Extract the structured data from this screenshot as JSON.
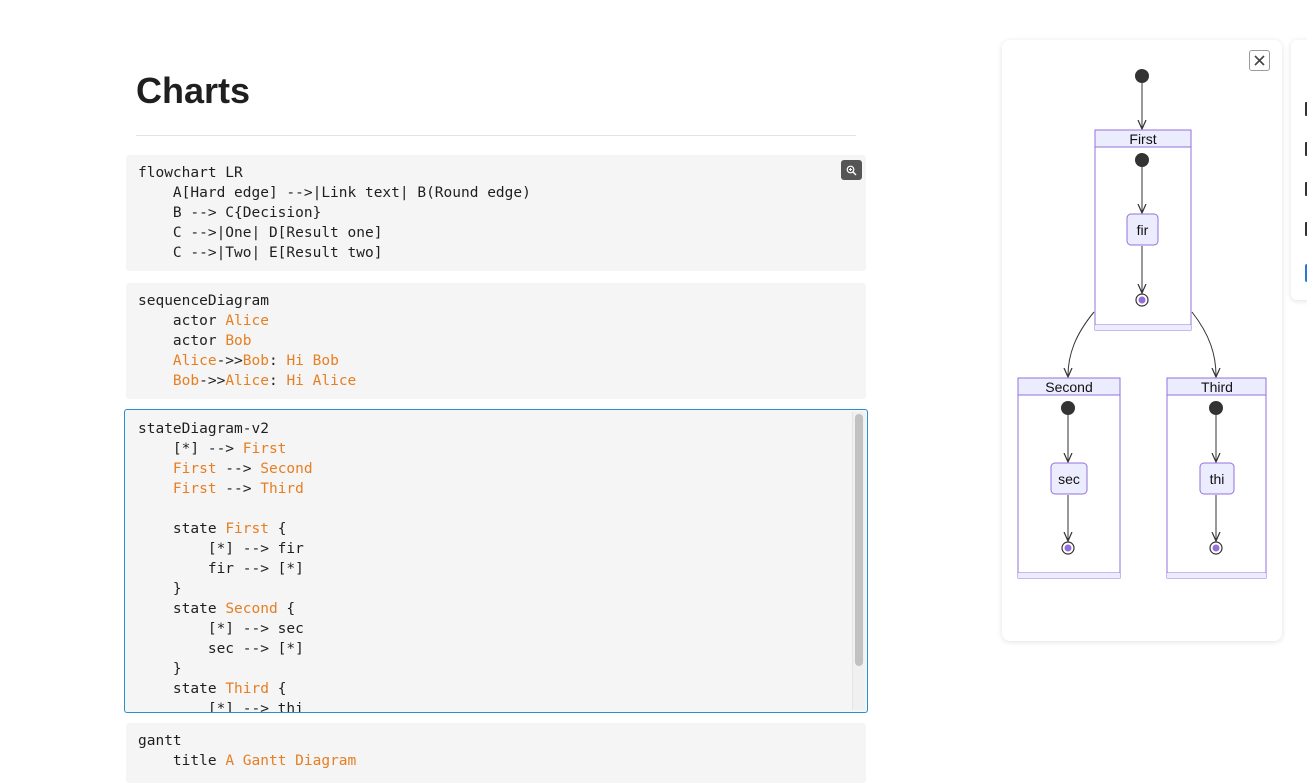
{
  "page": {
    "title": "Charts"
  },
  "code_blocks": {
    "flowchart": [
      "flowchart LR",
      "    A[Hard edge] -->|Link text| B(Round edge)",
      "    B --> C{Decision}",
      "    C -->|One| D[Result one]",
      "    C -->|Two| E[Result two]"
    ],
    "sequence": {
      "l0": "sequenceDiagram",
      "l1a": "    actor ",
      "l1b": "Alice",
      "l2a": "    actor ",
      "l2b": "Bob",
      "l3a": "    ",
      "l3b": "Alice",
      "l3c": "->>",
      "l3d": "Bob",
      "l3e": ": ",
      "l3f": "Hi Bob",
      "l4a": "    ",
      "l4b": "Bob",
      "l4c": "->>",
      "l4d": "Alice",
      "l4e": ": ",
      "l4f": "Hi Alice"
    },
    "state": {
      "l0": "stateDiagram-v2",
      "l1a": "    [*] --> ",
      "l1b": "First",
      "l2a": "    ",
      "l2b": "First",
      "l2c": " --> ",
      "l2d": "Second",
      "l3a": "    ",
      "l3b": "First",
      "l3c": " --> ",
      "l3d": "Third",
      "l4": " ",
      "l5a": "    state ",
      "l5b": "First",
      "l5c": " {",
      "l6": "        [*] --> fir",
      "l7": "        fir --> [*]",
      "l8": "    }",
      "l9a": "    state ",
      "l9b": "Second",
      "l9c": " {",
      "l10": "        [*] --> sec",
      "l11": "        sec --> [*]",
      "l12": "    }",
      "l13a": "    state ",
      "l13b": "Third",
      "l13c": " {",
      "l14": "        [*] --> thi"
    },
    "gantt": {
      "l0": "gantt",
      "l1a": "    title ",
      "l1b": "A Gantt Diagram"
    }
  },
  "diagram": {
    "states": [
      {
        "name": "First",
        "inner": "fir"
      },
      {
        "name": "Second",
        "inner": "sec"
      },
      {
        "name": "Third",
        "inner": "thi"
      }
    ]
  },
  "icons": {
    "zoom": "zoom-in-icon",
    "close": "close-icon"
  },
  "colors": {
    "accent_orange": "#e67e22",
    "state_border": "#9370db",
    "state_fill": "#ececff",
    "focus_border": "#2a8fcc"
  }
}
